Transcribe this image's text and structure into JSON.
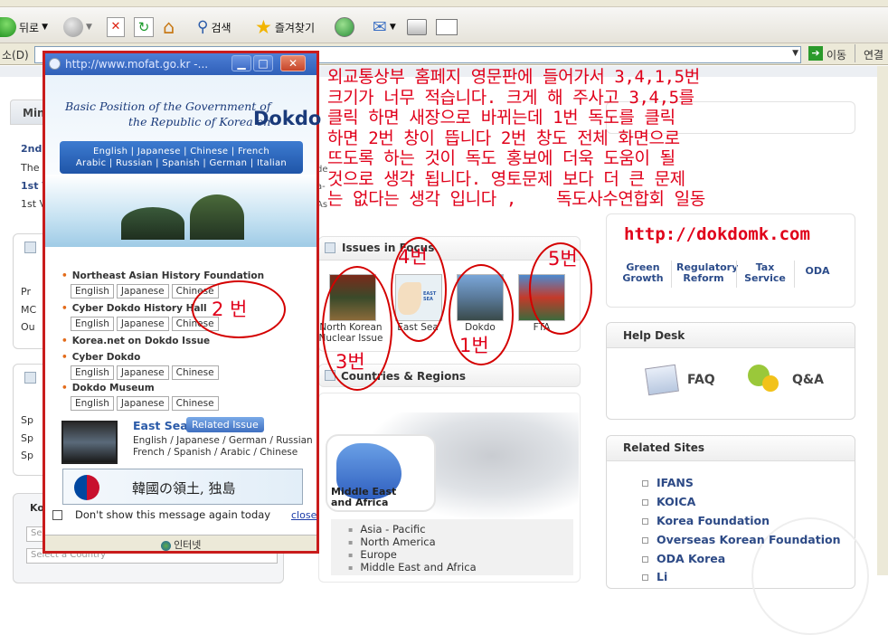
{
  "browser": {
    "back_label": "뒤로",
    "search_label": "검색",
    "favorites_label": "즐겨찾기",
    "address_label": "소(D)",
    "go_label": "이동",
    "links_label": "연결"
  },
  "popup": {
    "url": "http://www.mofat.go.kr -...",
    "heading_line1": "Basic Position of the Government of",
    "heading_line2": "the Republic of Korea on",
    "heading_brand": "Dokdo",
    "langs_row1": "English  |  Japanese  |  Chinese  |  French",
    "langs_row2": "Arabic  |  Russian  |  Spanish  |  German  |  Italian",
    "sections": [
      {
        "title": "Northeast Asian History Foundation",
        "buttons": [
          "English",
          "Japanese",
          "Chinese"
        ]
      },
      {
        "title": "Cyber Dokdo History Hall",
        "buttons": [
          "English",
          "Japanese",
          "Chinese"
        ]
      },
      {
        "title": "Korea.net on Dokdo Issue",
        "buttons": []
      },
      {
        "title": "Cyber Dokdo",
        "buttons": [
          "English",
          "Japanese",
          "Chinese"
        ]
      },
      {
        "title": "Dokdo Museum",
        "buttons": [
          "English",
          "Japanese",
          "Chinese"
        ]
      }
    ],
    "eastsea_title": "East Sea",
    "related_issue": "Related Issue",
    "eastsea_langs1": "English / Japanese / German / Russian",
    "eastsea_langs2": "French / Spanish / Arabic / Chinese",
    "banner_text": "韓國の領土, 独島",
    "dont_show": "Don't show this message again today",
    "close": "close",
    "status": "인터넷"
  },
  "page": {
    "left_tab": "Min",
    "left_lines": [
      "2nd",
      "The",
      "1st V",
      "1st V"
    ],
    "left_bullets1": [
      "Pr",
      "MC",
      "Ou"
    ],
    "left_bullets2": [
      "Sp",
      "Sp",
      "Sp"
    ],
    "left_ko": "Ko",
    "left_select1": "Se",
    "left_select2": "Select a Country",
    "mid_peek": [
      "de",
      "a-",
      "As"
    ],
    "issues_title": "Issues in Focus",
    "issues": [
      {
        "label": "North Korean Nuclear Issue"
      },
      {
        "label": "East Sea"
      },
      {
        "label": "Dokdo"
      },
      {
        "label": "FTA"
      }
    ],
    "east_sea_map_label": "EAST SEA",
    "countries_title": "Countries & Regions",
    "map_region": "Middle East and Africa",
    "regions": [
      "Asia - Pacific",
      "North America",
      "Europe",
      "Middle East and Africa"
    ],
    "green_buttons": [
      "Green Growth",
      "Regulatory Reform",
      "Tax Service",
      "ODA"
    ],
    "help_desk": "Help Desk",
    "faq": "FAQ",
    "qa": "Q&A",
    "related_sites": "Related Sites",
    "sites": [
      "IFANS",
      "KOICA",
      "Korea Foundation",
      "Overseas Korean Foundation",
      "ODA Korea",
      "Li"
    ]
  },
  "annotation": {
    "text": "외교통상부 홈페지 영문판에 들어가서 3,4,1,5번\n크기가 너무 적습니다. 크게 해 주사고 3,4,5를\n클릭 하면 새장으로 바뀌는데 1번 독도를 클릭\n하면 2번 창이 뜹니다 2번 창도 전체 화면으로\n뜨도록 하는 것이 독도 홍보에 더욱 도움이 될\n것으로 생각 됩니다. 영토문제 보다 더 큰 문제\n는 없다는 생각 입니다 ,    독도사수연합회 일동",
    "url": "http://dokdomk.com",
    "label2": "2 번",
    "label3": "3번",
    "label4": "4번",
    "label1": "1번",
    "label5": "5번"
  }
}
